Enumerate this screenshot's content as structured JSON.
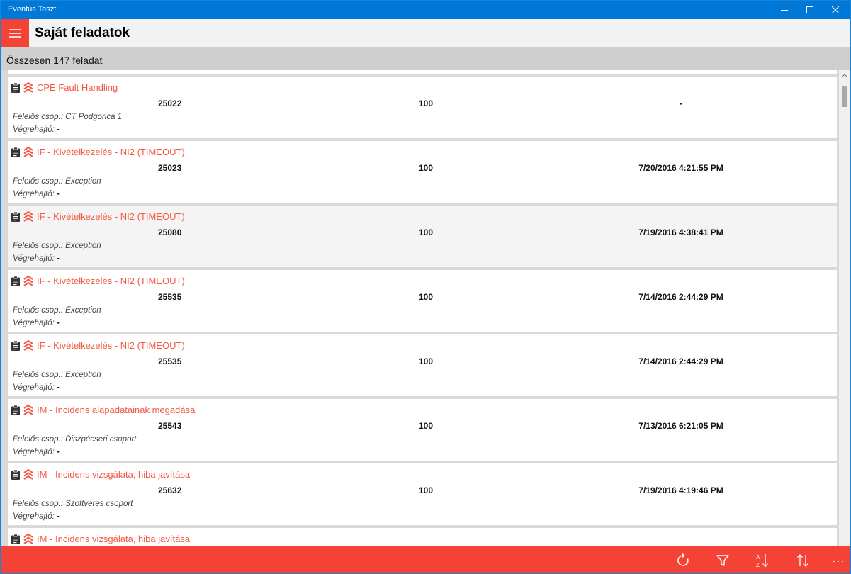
{
  "window": {
    "title": "Eventus Teszt"
  },
  "header": {
    "title": "Saját feladatok"
  },
  "summary": {
    "count_text": "Összesen 147 feladat"
  },
  "labels": {
    "group_prefix": "Felelős csop.: ",
    "executor_prefix": "Végrehajtó: "
  },
  "colors": {
    "accent": "#f44336",
    "titlebar": "#0078d7",
    "task_name": "#f25a45"
  },
  "icons": {
    "task": "clipboard-icon",
    "priority": "priority-chevrons-icon",
    "refresh": "refresh-icon",
    "filter": "filter-icon",
    "sort_az": "sort-az-icon",
    "sort_direction": "sort-direction-icon",
    "more": "more-icon",
    "menu": "hamburger-icon"
  },
  "tasks": [
    {
      "name": "CPE Fault Handling",
      "id": "25022",
      "percent": "100",
      "date": "-",
      "group": "CT Podgorica 1",
      "executor": "-"
    },
    {
      "name": "IF - Kivételkezelés - NI2 (TIMEOUT)",
      "id": "25023",
      "percent": "100",
      "date": "7/20/2016 4:21:55 PM",
      "group": "Exception",
      "executor": "-"
    },
    {
      "name": "IF - Kivételkezelés - NI2 (TIMEOUT)",
      "id": "25080",
      "percent": "100",
      "date": "7/19/2016 4:38:41 PM",
      "group": "Exception",
      "executor": "-"
    },
    {
      "name": "IF - Kivételkezelés - NI2 (TIMEOUT)",
      "id": "25535",
      "percent": "100",
      "date": "7/14/2016 2:44:29 PM",
      "group": "Exception",
      "executor": "-"
    },
    {
      "name": "IF - Kivételkezelés - NI2 (TIMEOUT)",
      "id": "25535",
      "percent": "100",
      "date": "7/14/2016 2:44:29 PM",
      "group": "Exception",
      "executor": "-"
    },
    {
      "name": "IM - Incidens alapadatainak megadása",
      "id": "25543",
      "percent": "100",
      "date": "7/13/2016 6:21:05 PM",
      "group": "Diszpécseri csoport",
      "executor": "-"
    },
    {
      "name": "IM - Incidens vizsgálata, hiba javítása",
      "id": "25632",
      "percent": "100",
      "date": "7/19/2016 4:19:46 PM",
      "group": "Szoftveres csoport",
      "executor": "-"
    },
    {
      "name": "IM - Incidens vizsgálata, hiba javítása",
      "id": "",
      "percent": "",
      "date": "",
      "group": "",
      "executor": ""
    }
  ]
}
